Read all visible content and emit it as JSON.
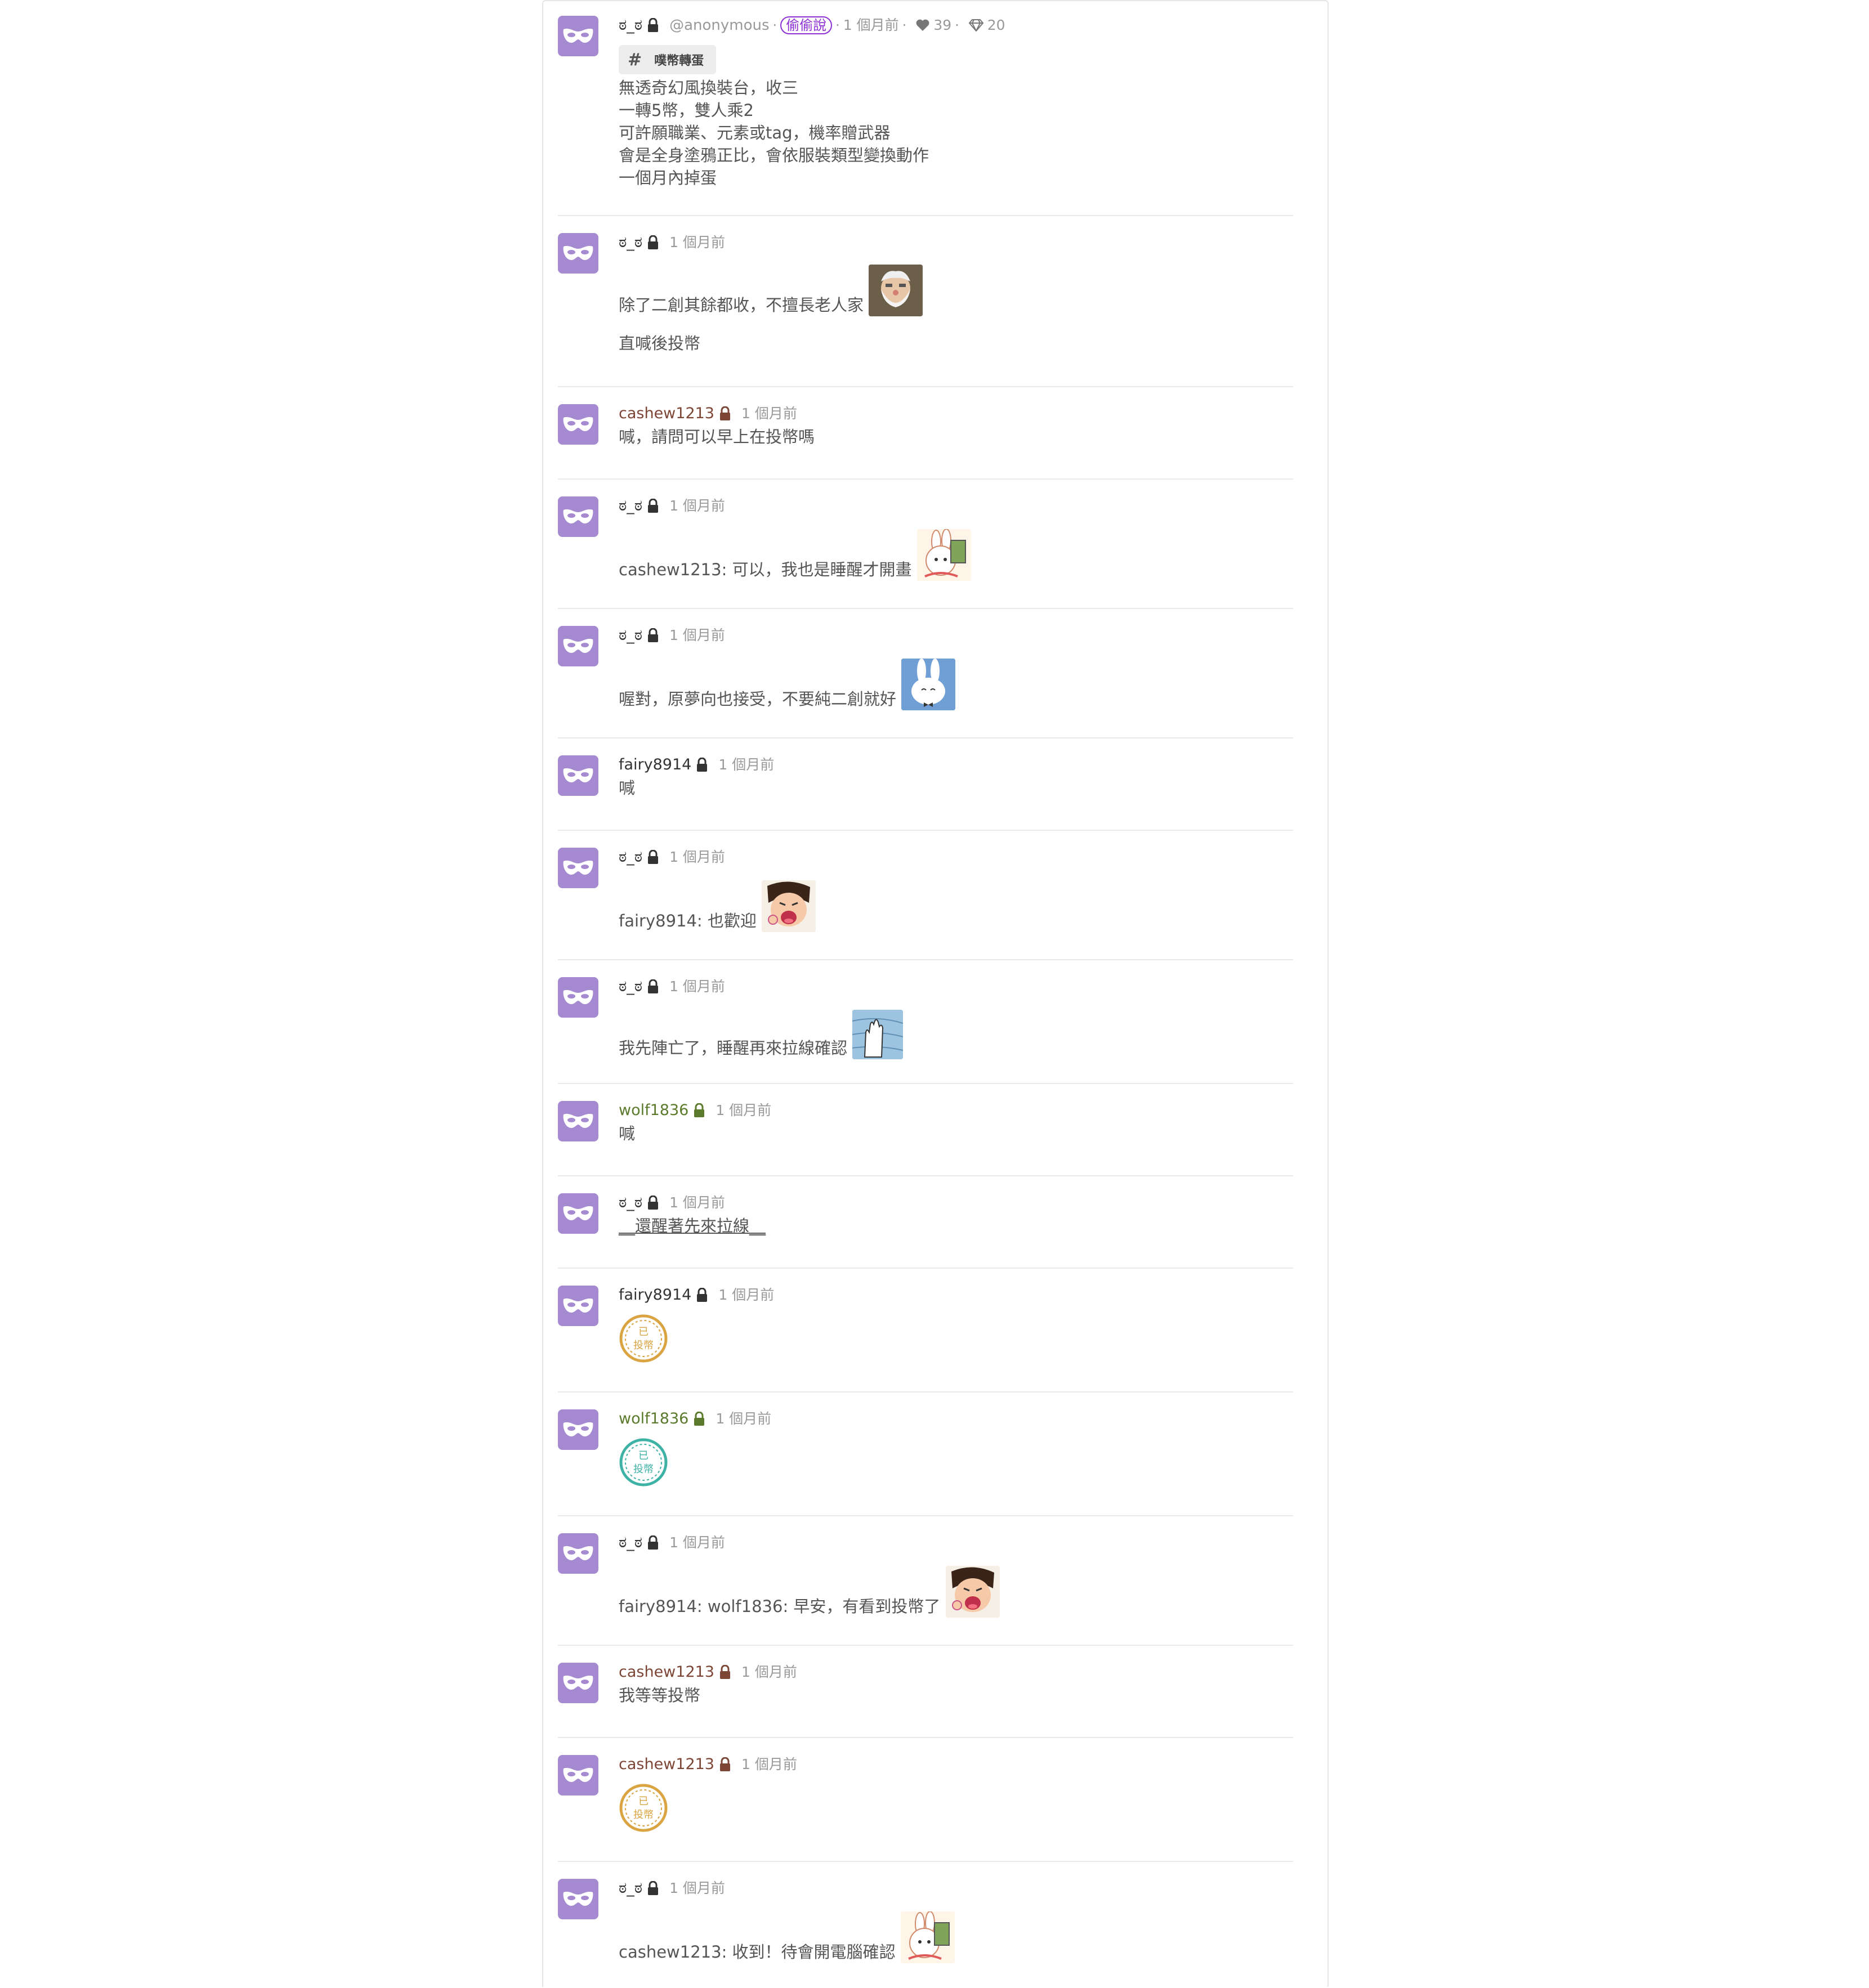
{
  "posts": [
    {
      "nick": "ಠ_ಠ",
      "handle": "@anonymous",
      "badge": "偷偷說",
      "time": "1 個月前",
      "likes": "39",
      "replurks": "20",
      "tag": "噗幣轉蛋",
      "lines": [
        "無透奇幻風換裝台，收三",
        "一轉5幣，雙人乘2",
        "可許願職業、元素或tag，機率贈武器",
        "會是全身塗鴉正比，會依服裝類型變換動作",
        "一個月內掉蛋"
      ]
    },
    {
      "nick": "ಠ_ಠ",
      "time": "1 個月前",
      "text1": "除了二創其餘都收，不擅長老人家",
      "text2": "直喊後投幣",
      "sticker": "old-man-sticker"
    },
    {
      "nick": "cashew1213",
      "time": "1 個月前",
      "text": "喊，請問可以早上在投幣嗎"
    },
    {
      "nick": "ಠ_ಠ",
      "time": "1 個月前",
      "text": "cashew1213: 可以，我也是睡醒才開畫",
      "sticker": "rabbit-card-sticker"
    },
    {
      "nick": "ಠ_ಠ",
      "time": "1 個月前",
      "text": "喔對，原夢向也接受，不要純二創就好",
      "sticker": "rabbit-bowtie-sticker"
    },
    {
      "nick": "fairy8914",
      "time": "1 個月前",
      "text": "喊"
    },
    {
      "nick": "ಠ_ಠ",
      "time": "1 個月前",
      "text": "fairy8914: 也歡迎",
      "sticker": "girl-laugh-sticker"
    },
    {
      "nick": "ಠ_ಠ",
      "time": "1 個月前",
      "text": "我先陣亡了，睡醒再來拉線確認",
      "sticker": "hand-wave-sticker"
    },
    {
      "nick": "wolf1836",
      "time": "1 個月前",
      "text": "喊"
    },
    {
      "nick": "ಠ_ಠ",
      "time": "1 個月前",
      "text": "__還醒著先來拉線__"
    },
    {
      "nick": "fairy8914",
      "time": "1 個月前",
      "stamp_text": "已投幣"
    },
    {
      "nick": "wolf1836",
      "time": "1 個月前",
      "stamp_text": "已投幣"
    },
    {
      "nick": "ಠ_ಠ",
      "time": "1 個月前",
      "text": "fairy8914: wolf1836: 早安，有看到投幣了",
      "sticker": "girl-laugh-sticker"
    },
    {
      "nick": "cashew1213",
      "time": "1 個月前",
      "text": "我等等投幣"
    },
    {
      "nick": "cashew1213",
      "time": "1 個月前",
      "stamp_text": "已投幣"
    },
    {
      "nick": "ಠ_ಠ",
      "time": "1 個月前",
      "text": "cashew1213: 收到！待會開電腦確認",
      "sticker": "rabbit-card-sticker"
    }
  ],
  "colors": {
    "avatar": "#a58ad1",
    "badge": "#8d2fd3",
    "nick_brown": "#7d4535",
    "nick_green": "#5c7a2c",
    "stamp_gold": "#d9a441",
    "stamp_teal": "#3fb2a6"
  },
  "icons": {
    "avatar": "mask-icon",
    "lock": "lock-icon",
    "like": "heart-icon",
    "replurk": "diamond-icon",
    "tag": "hash-icon"
  }
}
